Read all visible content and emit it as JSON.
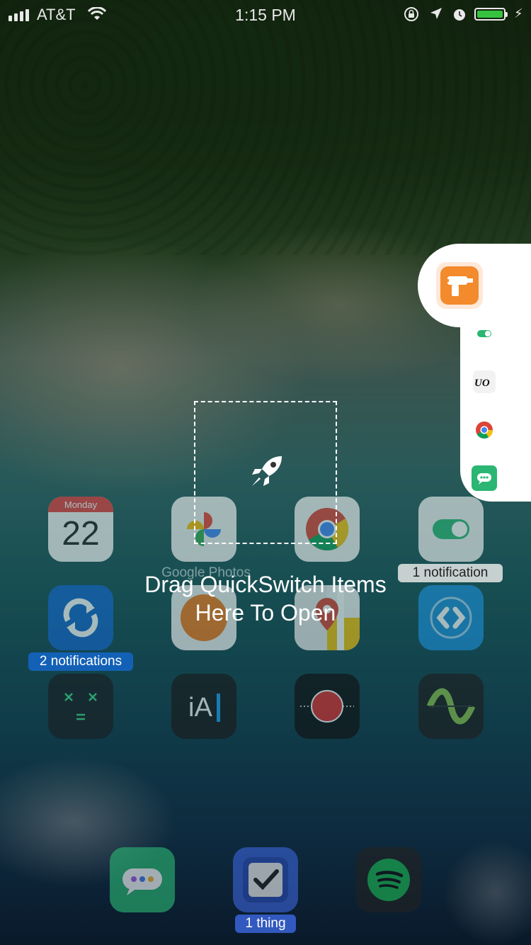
{
  "status_bar": {
    "carrier": "AT&T",
    "time": "1:15 PM",
    "battery_color": "#35c33f"
  },
  "home": {
    "apps": [
      {
        "id": "calendar",
        "day_name": "Monday",
        "day_number": "22"
      },
      {
        "id": "google-photos",
        "label": "Google Photos"
      },
      {
        "id": "chrome"
      },
      {
        "id": "toggle-app",
        "badge": "1 notification"
      },
      {
        "id": "sync-app",
        "badge": "2 notifications"
      },
      {
        "id": "overcast"
      },
      {
        "id": "maps"
      },
      {
        "id": "shazam"
      },
      {
        "id": "calculator"
      },
      {
        "id": "ia-writer",
        "text": "iA"
      },
      {
        "id": "recorder"
      },
      {
        "id": "waveform"
      }
    ],
    "dock": [
      {
        "id": "messages"
      },
      {
        "id": "things",
        "badge": "1 thing"
      },
      {
        "id": "spotify"
      }
    ]
  },
  "quickswitch": {
    "drop_text_line1": "Drag QuickSwitch Items",
    "drop_text_line2": "Here To Open",
    "items": [
      {
        "id": "drill-app",
        "color": "#f38a2c"
      },
      {
        "id": "toggle-app"
      },
      {
        "id": "uo-app",
        "text": "UO"
      },
      {
        "id": "chrome"
      },
      {
        "id": "messages",
        "color": "#2bb673"
      }
    ]
  }
}
